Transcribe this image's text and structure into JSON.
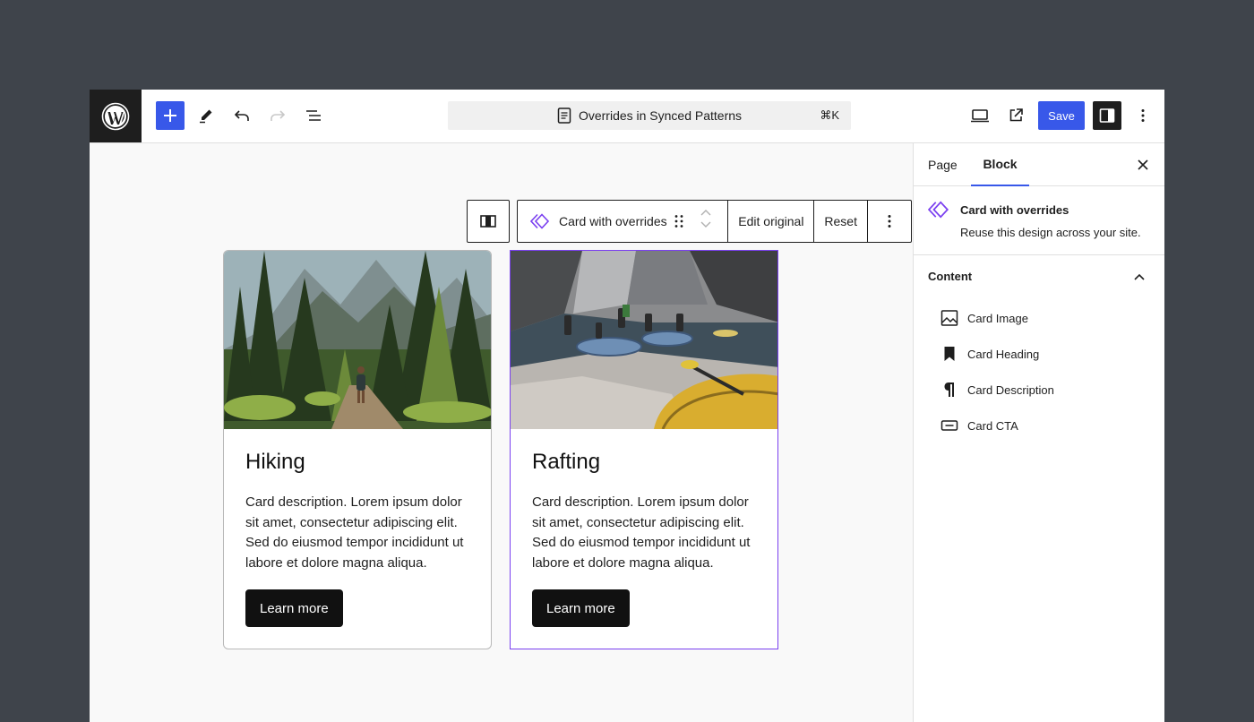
{
  "toolbar": {
    "doc_title": "Overrides in Synced Patterns",
    "shortcut": "⌘K",
    "save_label": "Save"
  },
  "block_toolbar": {
    "block_label": "Card with overrides",
    "edit_original_label": "Edit original",
    "reset_label": "Reset"
  },
  "cards": [
    {
      "heading": "Hiking",
      "description": "Card description. Lorem ipsum dolor sit amet, consectetur adipiscing elit. Sed do eiusmod tempor incididunt ut labore et dolore magna aliqua.",
      "cta": "Learn more"
    },
    {
      "heading": "Rafting",
      "description": "Card description. Lorem ipsum dolor sit amet, consectetur adipiscing elit. Sed do eiusmod tempor incididunt ut labore et dolore magna aliqua.",
      "cta": "Learn more"
    }
  ],
  "sidebar": {
    "tabs": [
      "Page",
      "Block"
    ],
    "active_tab": "Block",
    "block_title": "Card with overrides",
    "block_description": "Reuse this design across your site.",
    "panel_title": "Content",
    "items": [
      {
        "label": "Card Image",
        "icon": "image-icon"
      },
      {
        "label": "Card Heading",
        "icon": "bookmark-icon"
      },
      {
        "label": "Card Description",
        "icon": "paragraph-icon"
      },
      {
        "label": "Card CTA",
        "icon": "button-icon"
      }
    ]
  },
  "colors": {
    "accent": "#3858e9",
    "pattern": "#7a3ff0",
    "backdrop": "#3f444b",
    "dark": "#1e1e1e"
  }
}
